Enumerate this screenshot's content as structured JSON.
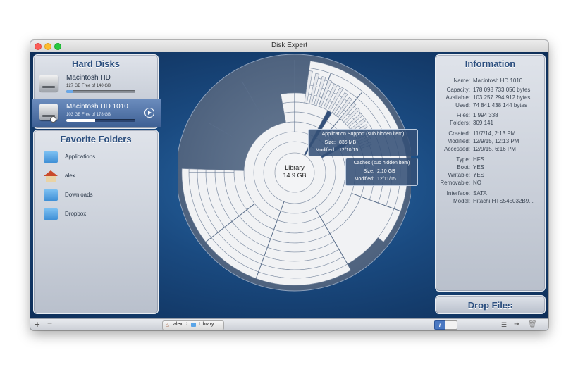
{
  "window": {
    "title": "Disk Expert"
  },
  "hard_disks": {
    "title": "Hard Disks",
    "items": [
      {
        "name": "Macintosh HD",
        "free": "127 GB Free of 140 GB",
        "used_fraction": 0.09
      },
      {
        "name": "Macintosh HD 1010",
        "free": "103 GB Free of 178 GB",
        "used_fraction": 0.42
      }
    ]
  },
  "favorites": {
    "title": "Favorite Folders",
    "items": [
      {
        "label": "Applications",
        "icon": "applications-folder-icon"
      },
      {
        "label": "alex",
        "icon": "home-folder-icon"
      },
      {
        "label": "Downloads",
        "icon": "downloads-folder-icon"
      },
      {
        "label": "Dropbox",
        "icon": "dropbox-folder-icon"
      }
    ]
  },
  "center": {
    "name": "Library",
    "size": "14.9 GB"
  },
  "tooltips": [
    {
      "title": "Application Support (sub hidden item)",
      "size_label": "Size:",
      "size": "836 MB",
      "modified_label": "Modified:",
      "modified": "12/10/15"
    },
    {
      "title": "Caches (sub hidden item)",
      "size_label": "Size:",
      "size": "2.10 GB",
      "modified_label": "Modified:",
      "modified": "12/11/15"
    }
  ],
  "information": {
    "title": "Information",
    "rows": [
      {
        "k": "Name:",
        "v": "Macintosh HD 1010"
      },
      {
        "k": "Capacity:",
        "v": "178 098 733 056 bytes"
      },
      {
        "k": "Available:",
        "v": "103 257 294 912 bytes"
      },
      {
        "k": "Used:",
        "v": "74 841 438 144 bytes"
      },
      {
        "k": "Files:",
        "v": "1 994 338"
      },
      {
        "k": "Folders:",
        "v": "309 141"
      },
      {
        "k": "Created:",
        "v": "11/7/14, 2:13 PM"
      },
      {
        "k": "Modified:",
        "v": "12/9/15, 12:13 PM"
      },
      {
        "k": "Accessed:",
        "v": "12/9/15, 6:16 PM"
      },
      {
        "k": "Type:",
        "v": "HFS"
      },
      {
        "k": "Boot:",
        "v": "YES"
      },
      {
        "k": "Writable:",
        "v": "YES"
      },
      {
        "k": "Removable:",
        "v": "NO"
      },
      {
        "k": "Interface:",
        "v": "SATA"
      },
      {
        "k": "Model:",
        "v": "Hitachi HTS545032B9..."
      }
    ]
  },
  "drop_files": {
    "label": "Drop Files"
  },
  "breadcrumb": {
    "items": [
      "alex",
      "Library"
    ]
  },
  "colors": {
    "accent": "#2b4e7e",
    "selection": "#4d6fa3",
    "background": "#1b3f6e"
  }
}
